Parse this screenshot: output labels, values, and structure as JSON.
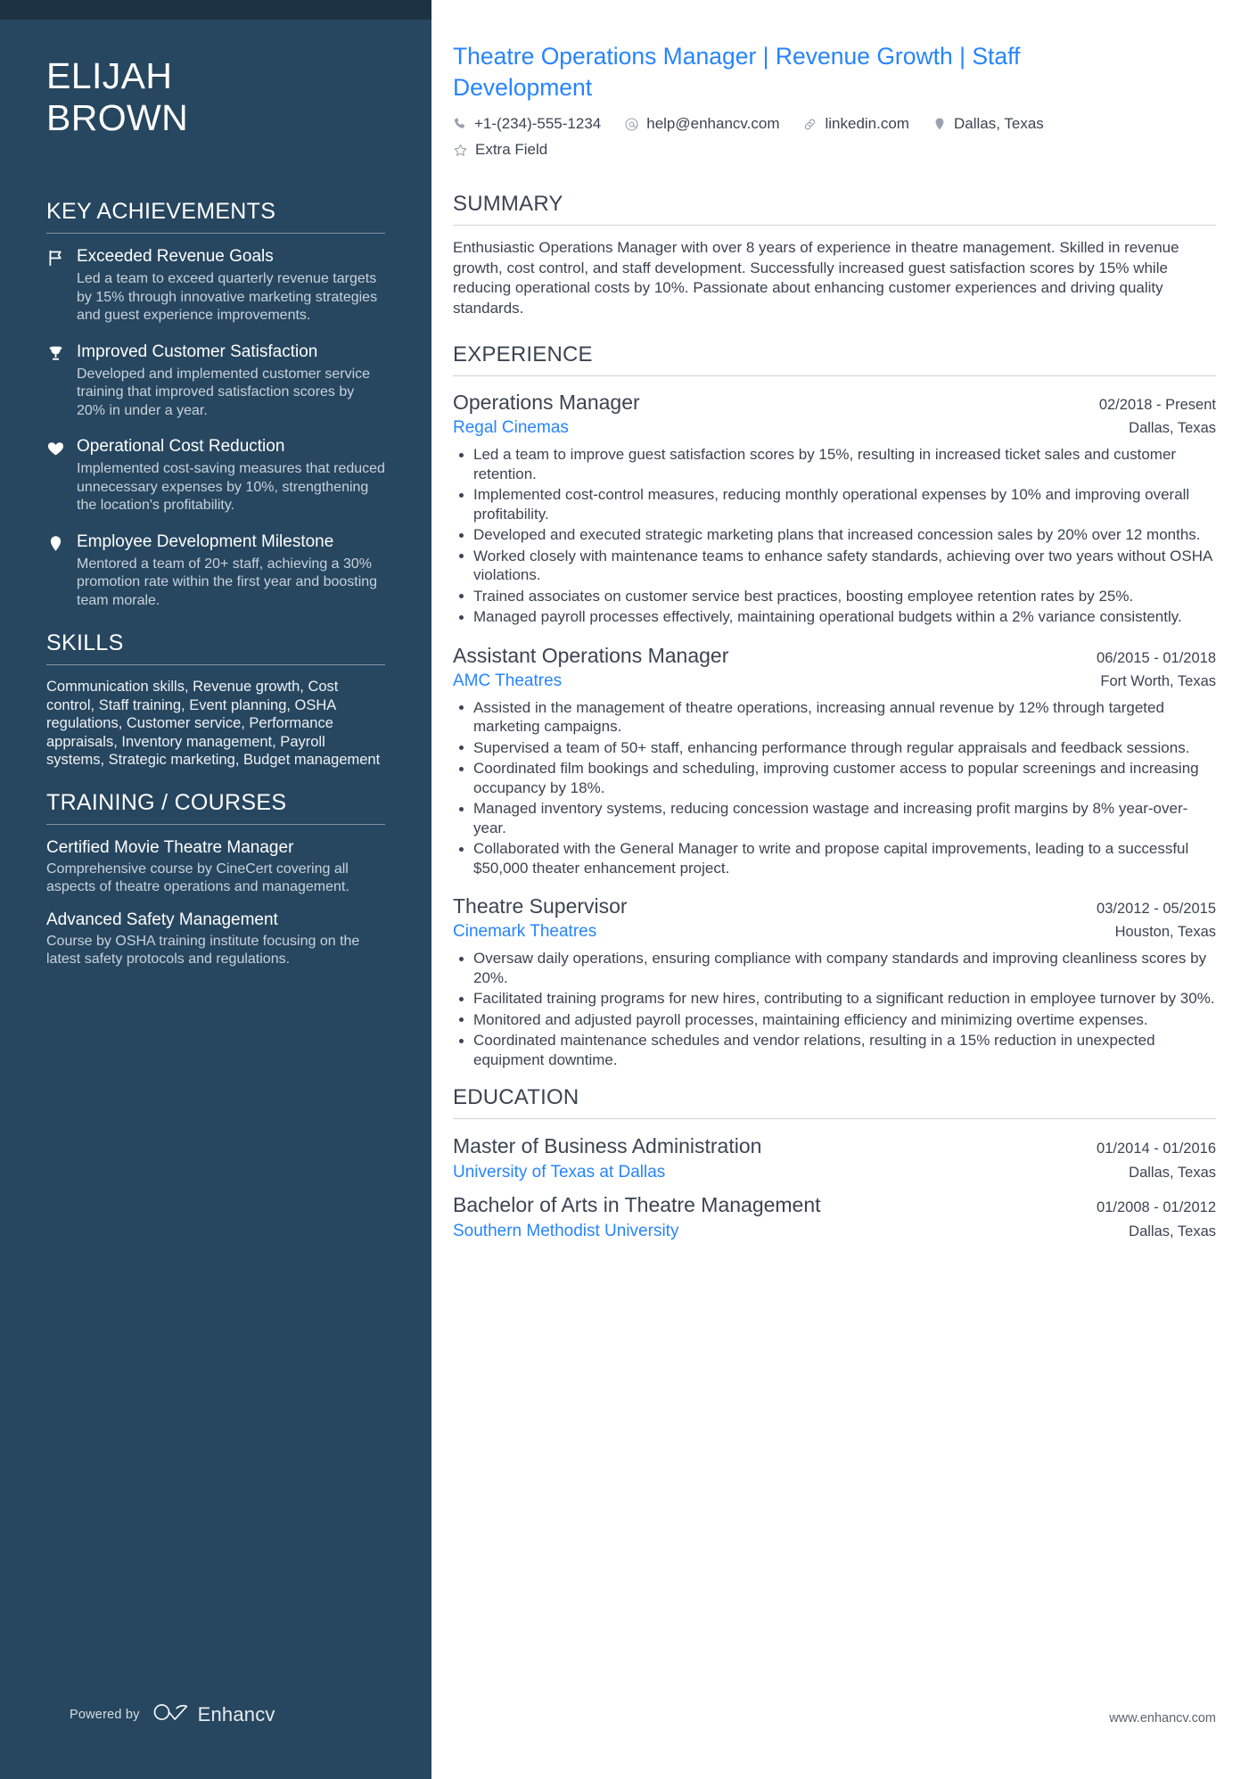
{
  "sidebar": {
    "name_first": "ELIJAH",
    "name_last": "BROWN",
    "achievements_heading": "KEY ACHIEVEMENTS",
    "achievements": [
      {
        "icon": "flag-icon",
        "title": "Exceeded Revenue Goals",
        "desc": "Led a team to exceed quarterly revenue targets by 15% through innovative marketing strategies and guest experience improvements."
      },
      {
        "icon": "trophy-icon",
        "title": "Improved Customer Satisfaction",
        "desc": "Developed and implemented customer service training that improved satisfaction scores by 20% in under a year."
      },
      {
        "icon": "heart-icon",
        "title": "Operational Cost Reduction",
        "desc": "Implemented cost-saving measures that reduced unnecessary expenses by 10%, strengthening the location's profitability."
      },
      {
        "icon": "map-pin-icon",
        "title": "Employee Development Milestone",
        "desc": "Mentored a team of 20+ staff, achieving a 30% promotion rate within the first year and boosting team morale."
      }
    ],
    "skills_heading": "SKILLS",
    "skills_text": "Communication skills, Revenue growth, Cost control, Staff training, Event planning, OSHA regulations, Customer service, Performance appraisals, Inventory management, Payroll systems, Strategic marketing, Budget management",
    "training_heading": "TRAINING / COURSES",
    "courses": [
      {
        "title": "Certified Movie Theatre Manager",
        "desc": "Comprehensive course by CineCert covering all aspects of theatre operations and management."
      },
      {
        "title": "Advanced Safety Management",
        "desc": "Course by OSHA training institute focusing on the latest safety protocols and regulations."
      }
    ],
    "powered_by_label": "Powered by",
    "brand_name": "Enhancv"
  },
  "main": {
    "headline": "Theatre Operations Manager | Revenue Growth | Staff Development",
    "contacts": [
      {
        "icon": "phone-icon",
        "text": "+1-(234)-555-1234"
      },
      {
        "icon": "at-icon",
        "text": "help@enhancv.com"
      },
      {
        "icon": "link-icon",
        "text": "linkedin.com"
      },
      {
        "icon": "map-pin-icon",
        "text": "Dallas, Texas"
      },
      {
        "icon": "star-icon",
        "text": "Extra Field"
      }
    ],
    "summary_heading": "SUMMARY",
    "summary_text": "Enthusiastic Operations Manager with over 8 years of experience in theatre management. Skilled in revenue growth, cost control, and staff development. Successfully increased guest satisfaction scores by 15% while reducing operational costs by 10%. Passionate about enhancing customer experiences and driving quality standards.",
    "experience_heading": "EXPERIENCE",
    "jobs": [
      {
        "title": "Operations Manager",
        "date": "02/2018 - Present",
        "company": "Regal Cinemas",
        "location": "Dallas, Texas",
        "bullets": [
          "Led a team to improve guest satisfaction scores by 15%, resulting in increased ticket sales and customer retention.",
          "Implemented cost-control measures, reducing monthly operational expenses by 10% and improving overall profitability.",
          "Developed and executed strategic marketing plans that increased concession sales by 20% over 12 months.",
          "Worked closely with maintenance teams to enhance safety standards, achieving over two years without OSHA violations.",
          "Trained associates on customer service best practices, boosting employee retention rates by 25%.",
          "Managed payroll processes effectively, maintaining operational budgets within a 2% variance consistently."
        ]
      },
      {
        "title": "Assistant Operations Manager",
        "date": "06/2015 - 01/2018",
        "company": "AMC Theatres",
        "location": "Fort Worth, Texas",
        "bullets": [
          "Assisted in the management of theatre operations, increasing annual revenue by 12% through targeted marketing campaigns.",
          "Supervised a team of 50+ staff, enhancing performance through regular appraisals and feedback sessions.",
          "Coordinated film bookings and scheduling, improving customer access to popular screenings and increasing occupancy by 18%.",
          "Managed inventory systems, reducing concession wastage and increasing profit margins by 8% year-over-year.",
          "Collaborated with the General Manager to write and propose capital improvements, leading to a successful $50,000 theater enhancement project."
        ]
      },
      {
        "title": "Theatre Supervisor",
        "date": "03/2012 - 05/2015",
        "company": "Cinemark Theatres",
        "location": "Houston, Texas",
        "bullets": [
          "Oversaw daily operations, ensuring compliance with company standards and improving cleanliness scores by 20%.",
          "Facilitated training programs for new hires, contributing to a significant reduction in employee turnover by 30%.",
          "Monitored and adjusted payroll processes, maintaining efficiency and minimizing overtime expenses.",
          "Coordinated maintenance schedules and vendor relations, resulting in a 15% reduction in unexpected equipment downtime."
        ]
      }
    ],
    "education_heading": "EDUCATION",
    "education": [
      {
        "title": "Master of Business Administration",
        "date": "01/2014 - 01/2016",
        "school": "University of Texas at Dallas",
        "location": "Dallas, Texas"
      },
      {
        "title": "Bachelor of Arts in Theatre Management",
        "date": "01/2008 - 01/2012",
        "school": "Southern Methodist University",
        "location": "Dallas, Texas"
      }
    ],
    "site_url": "www.enhancv.com"
  },
  "colors": {
    "sidebar_bg": "#27465f",
    "sidebar_topbar": "#1d3344",
    "accent_blue": "#2684ff",
    "body_text": "#3b4450"
  }
}
